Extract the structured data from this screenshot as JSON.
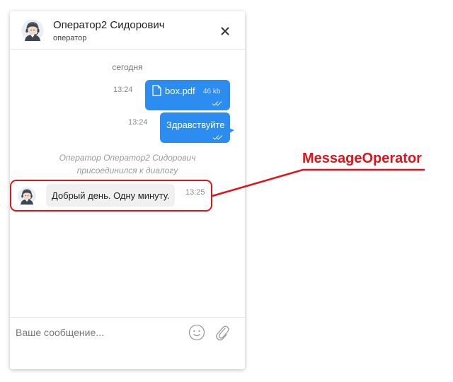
{
  "header": {
    "operator_name": "Оператор2 Сидорович",
    "operator_role": "оператор",
    "close_icon": "close-icon",
    "avatar_icon": "operator-headset-avatar-icon"
  },
  "conversation": {
    "day_label": "сегодня",
    "messages": [
      {
        "direction": "outgoing",
        "kind": "file",
        "time": "13:24",
        "file_name": "box.pdf",
        "file_size": "46 kb",
        "status_icon": "double-check-icon"
      },
      {
        "direction": "outgoing",
        "kind": "text",
        "time": "13:24",
        "text": "Здравствуйте",
        "status_icon": "double-check-icon"
      },
      {
        "direction": "system",
        "kind": "notice",
        "line1": "Оператор Оператор2 Сидорович",
        "line2": "присоединился к диалогу"
      },
      {
        "direction": "incoming",
        "kind": "text",
        "time": "13:25",
        "text": "Добрый день. Одну минуту."
      }
    ]
  },
  "composer": {
    "placeholder": "Ваше сообщение...",
    "value": "",
    "emoji_icon": "smiley-icon",
    "attach_icon": "paperclip-icon"
  },
  "annotation": {
    "label": "MessageOperator",
    "color": "#e0121a"
  },
  "colors": {
    "outgoing_bubble": "#2d8cf0",
    "incoming_bubble": "#f0f0f0",
    "annotation": "#e0121a"
  }
}
